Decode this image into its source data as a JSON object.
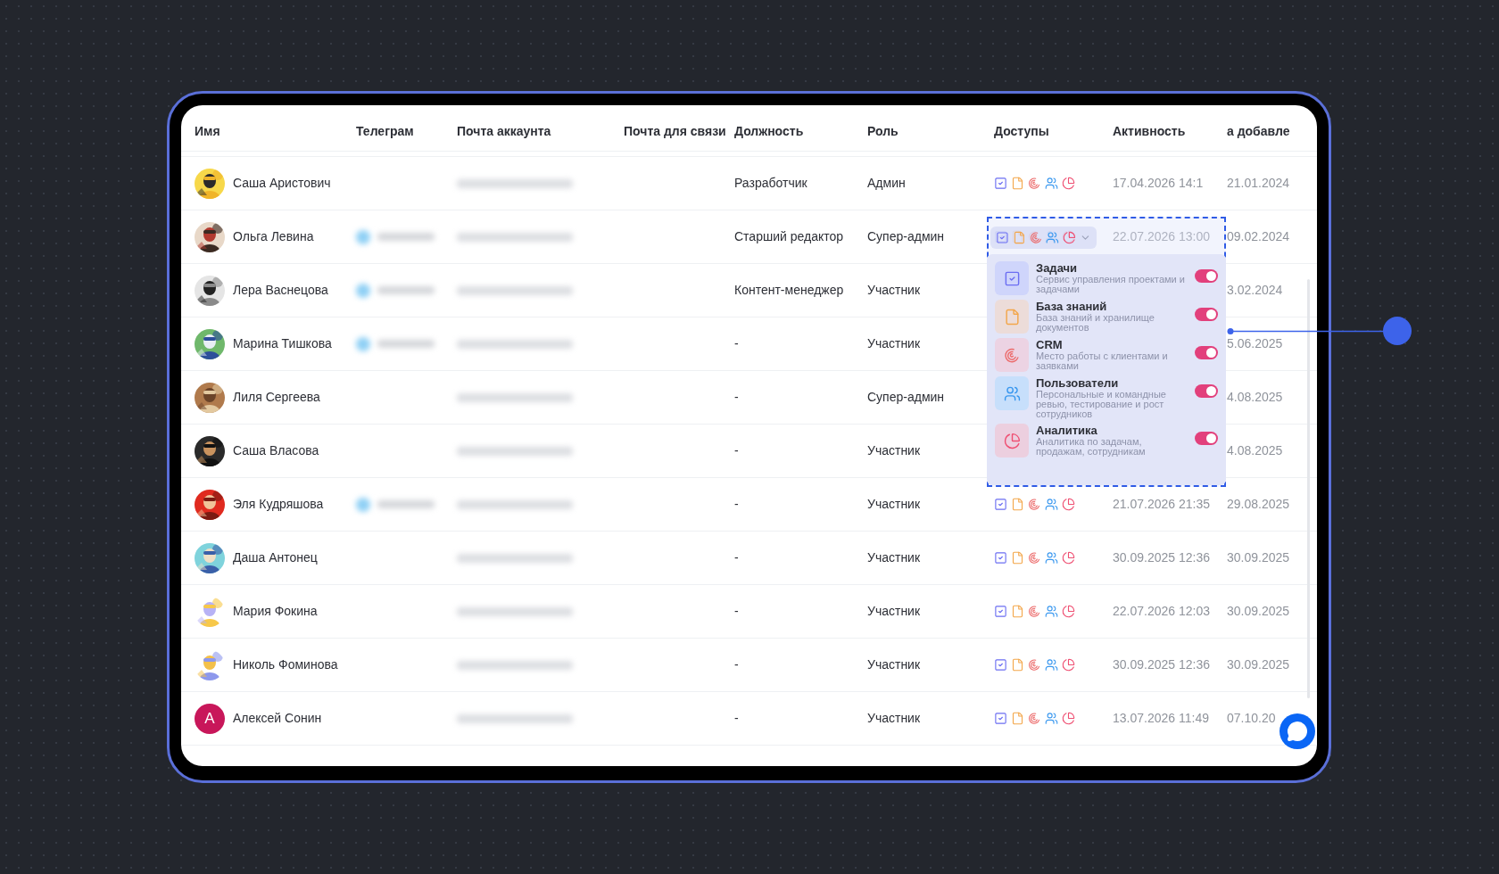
{
  "columns": [
    "Имя",
    "Телеграм",
    "Почта аккаунта",
    "Почта для связи",
    "Должность",
    "Роль",
    "Доступы",
    "Активность",
    "а добавле"
  ],
  "rows": [
    {
      "name": "Саша Аристович",
      "telegram_linked": false,
      "position": "Разработчик",
      "role": "Админ",
      "activity": "17.04.2026 14:1",
      "date": "21.01.2024"
    },
    {
      "name": "Ольга Левина",
      "telegram_linked": true,
      "position": "Старший редактор",
      "role": "Супер-админ",
      "activity": "22.07.2026 13:00",
      "date": "09.02.2024"
    },
    {
      "name": "Лера Васнецова",
      "telegram_linked": true,
      "position": "Контент-менеджер",
      "role": "Участник",
      "date": "3.02.2024"
    },
    {
      "name": "Марина Тишкова",
      "telegram_linked": true,
      "position": "-",
      "role": "Участник",
      "date": "5.06.2025"
    },
    {
      "name": "Лиля Сергеева",
      "telegram_linked": false,
      "position": "-",
      "role": "Супер-админ",
      "date": "4.08.2025"
    },
    {
      "name": "Саша Власова",
      "telegram_linked": false,
      "position": "-",
      "role": "Участник",
      "date": "4.08.2025"
    },
    {
      "name": "Эля Кудряшова",
      "telegram_linked": true,
      "position": "-",
      "role": "Участник",
      "activity": "21.07.2026 21:35",
      "date": "29.08.2025"
    },
    {
      "name": "Даша Антонец",
      "telegram_linked": false,
      "position": "-",
      "role": "Участник",
      "activity": "30.09.2025 12:36",
      "date": "30.09.2025"
    },
    {
      "name": "Мария Фокина",
      "telegram_linked": false,
      "position": "-",
      "role": "Участник",
      "activity": "22.07.2026 12:03",
      "date": "30.09.2025"
    },
    {
      "name": "Николь Фоминова",
      "telegram_linked": false,
      "position": "-",
      "role": "Участник",
      "activity": "30.09.2025 12:36",
      "date": "30.09.2025"
    },
    {
      "avatar": {
        "kind": "letter",
        "letter": "А"
      },
      "name": "Алексей Сонин",
      "telegram_linked": false,
      "position": "-",
      "role": "Участник",
      "activity": "13.07.2026 11:49",
      "date": "07.10.20"
    }
  ],
  "services": [
    {
      "kind": "tasks",
      "title": "Задачи",
      "description": "Сервис управления проектами и задачами",
      "on": true
    },
    {
      "kind": "docs",
      "title": "База знаний",
      "description": "База знаний и хранилище документов",
      "on": true
    },
    {
      "kind": "crm",
      "title": "CRM",
      "description": "Место работы с клиентами и заявками",
      "on": true
    },
    {
      "kind": "users",
      "title": "Пользователи",
      "description": "Персональные и командные ревью, тестирование и рост сотрудников",
      "on": true
    },
    {
      "kind": "analytics",
      "title": "Аналитика",
      "description": "Аналитика по задачам, продажам, сотрудникам",
      "on": true
    }
  ]
}
